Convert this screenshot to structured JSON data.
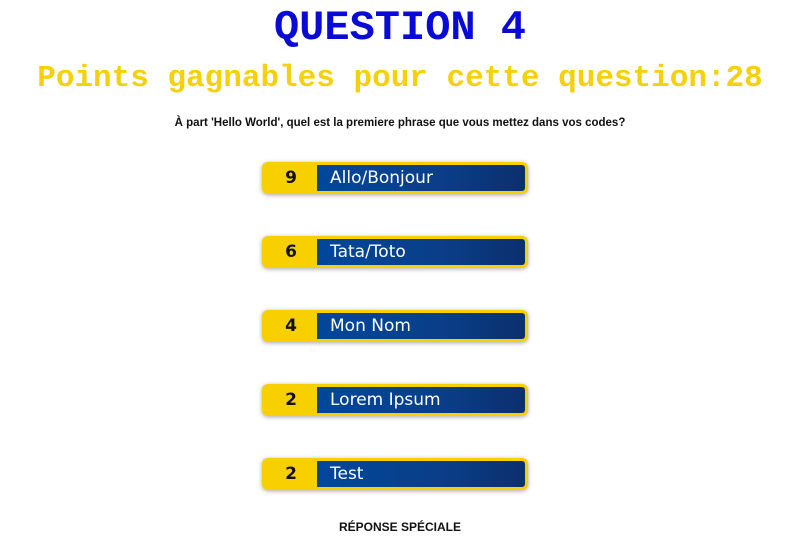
{
  "title": "QUESTION 4",
  "subtitle": "Points gagnables pour cette question:28",
  "prompt": "À part 'Hello World', quel est la premiere phrase que vous mettez dans vos codes?",
  "answers": [
    {
      "points": "9",
      "label": "Allo/Bonjour"
    },
    {
      "points": "6",
      "label": "Tata/Toto"
    },
    {
      "points": "4",
      "label": "Mon Nom"
    },
    {
      "points": "2",
      "label": "Lorem Ipsum"
    },
    {
      "points": "2",
      "label": "Test"
    }
  ],
  "special_answer": "RÉPONSE SPÉCIALE",
  "colors": {
    "title": "#0a0ad6",
    "subtitle": "#f5d00b",
    "answer_border": "#f8d000",
    "answer_background": "#00479a"
  }
}
